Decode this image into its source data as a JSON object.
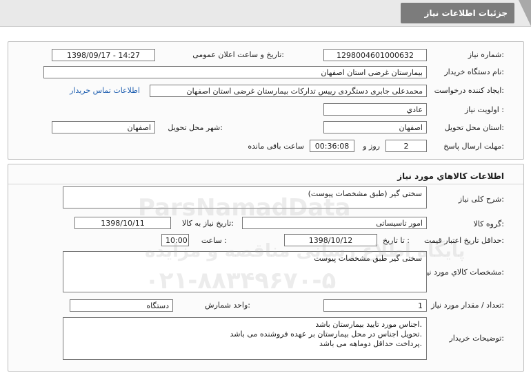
{
  "page_title": "جزئیات اطلاعات نیاز",
  "general": {
    "need_number_label": "شماره نیاز:",
    "need_number": "1298004601000632",
    "announce_datetime_label": "تاریخ و ساعت اعلان عمومی:",
    "announce_datetime": "1398/09/17 - 14:27",
    "buyer_org_label": "نام دستگاه خریدار:",
    "buyer_org": "بیمارستان غرضی استان اصفهان",
    "creator_label": "ایجاد کننده درخواست:",
    "creator": "محمدعلی جابری دستگردی رییس تدارکات بیمارستان غرضی استان اصفهان",
    "contact_link": "اطلاعات تماس خریدار",
    "priority_label": "اولویت نیاز :",
    "priority": "عادي",
    "province_label": "استان محل تحویل:",
    "province": "اصفهان",
    "city_label": "شهر محل تحویل:",
    "city": "اصفهان",
    "deadline_label": "مهلت ارسال پاسخ:",
    "days": "2",
    "days_label": "روز و",
    "time_left": "00:36:08",
    "time_left_label": "ساعت باقی مانده"
  },
  "goods": {
    "section_title": "اطلاعات كالاهاي مورد نياز",
    "summary_label": "شرح کلی نیاز:",
    "summary": "سختی گیر (طبق مشخصات پیوست)",
    "group_label": "گروه کالا:",
    "group": "امور تاسیساتی",
    "need_date_label": "تاریخ نیاز به کالا:",
    "need_date": "1398/10/11",
    "min_validity_label": "حداقل تاریخ اعتبار قیمت:",
    "to_date_label": "تا تاریخ :",
    "to_date": "1398/10/12",
    "hour_label": "ساعت :",
    "hour": "10:00",
    "spec_label": "مشخصات كالاي مورد نياز:",
    "spec": "سختی گیر طبق مشخصات پیوست",
    "qty_label": "تعداد / مقدار مورد نیاز:",
    "qty": "1",
    "unit_label": "واحد شمارش:",
    "unit": "دستگاه",
    "buyer_notes_label": "توضیحات خریدار:",
    "buyer_notes": [
      "اجناس مورد تایید بیمارستان باشد.",
      "تحویل اجناس در محل بیمارستان بر عهده فروشنده می باشد.",
      "پرداخت حداقل دوماهه می باشد."
    ]
  },
  "watermark": {
    "brand": "ParsNamadData",
    "tagline": "پایگاه اطلاع رسانی مناقصه و مزایده",
    "phone": "۰۲۱-۸۸۳۴۹۶۷۰-۵"
  }
}
